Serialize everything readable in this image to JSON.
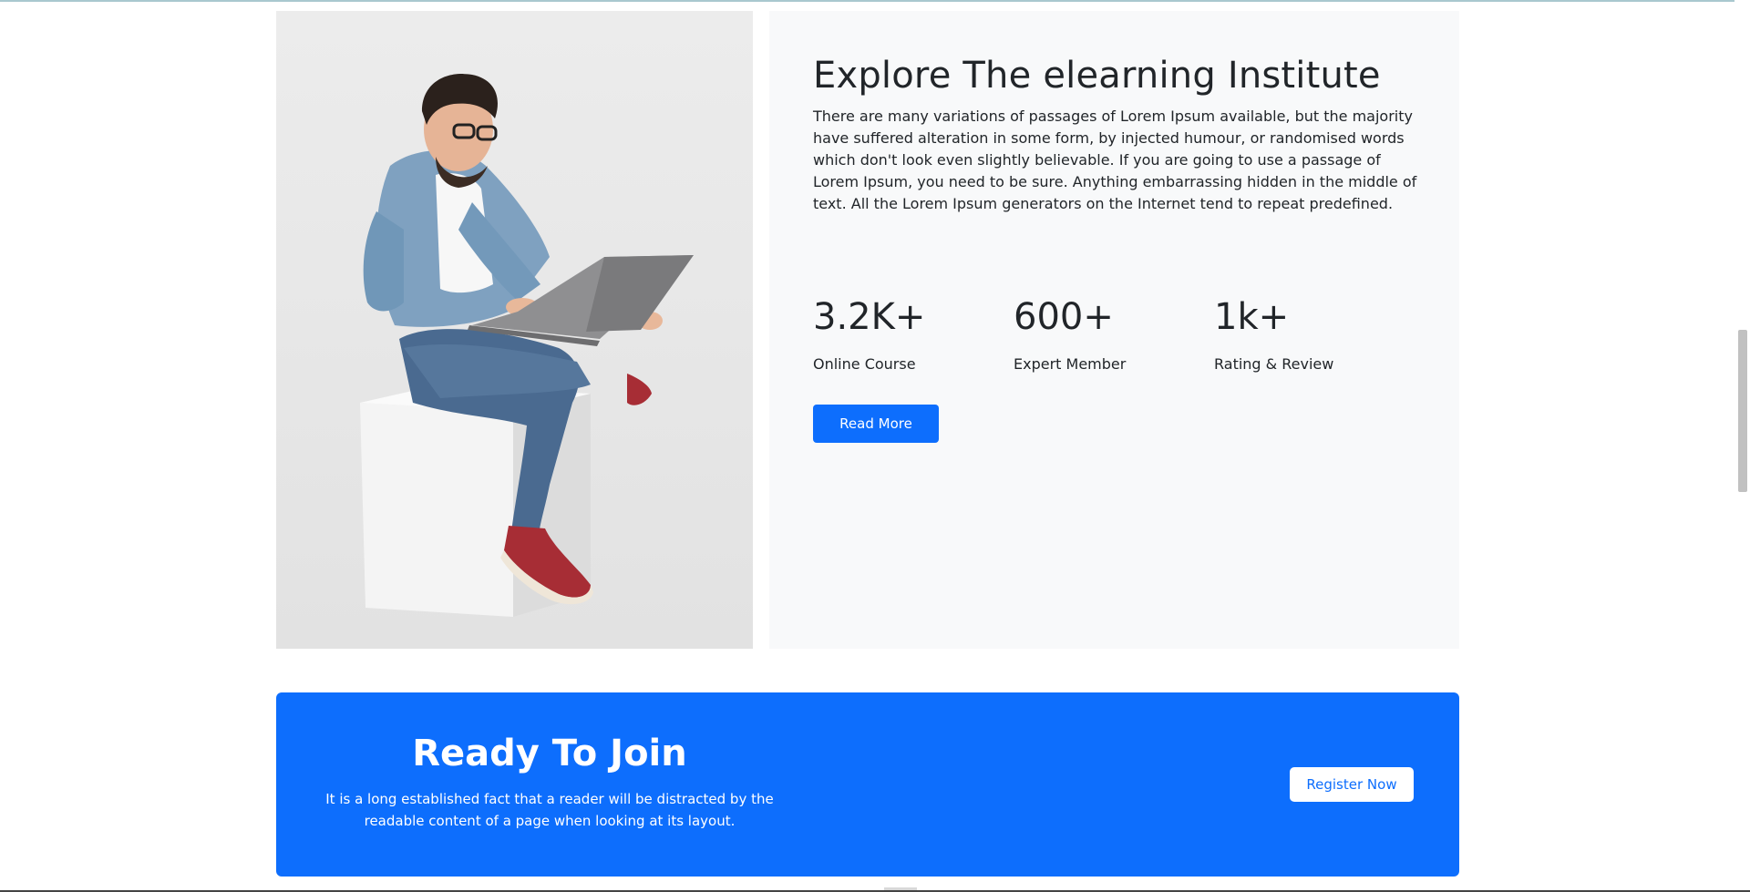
{
  "about": {
    "title": "Explore The elearning Institute",
    "description": "There are many variations of passages of Lorem Ipsum available, but the majority have suffered alteration in some form, by injected humour, or randomised words which don't look even slightly believable. If you are going to use a passage of Lorem Ipsum, you need to be sure. Anything embarrassing hidden in the middle of text. All the Lorem Ipsum generators on the Internet tend to repeat predefined.",
    "stats": [
      {
        "value": "3.2K+",
        "label": "Online Course"
      },
      {
        "value": "600+",
        "label": "Expert Member"
      },
      {
        "value": "1k+",
        "label": "Rating & Review"
      }
    ],
    "read_more_label": "Read More"
  },
  "cta": {
    "title": "Ready To Join",
    "text": "It is a long established fact that a reader will be distracted by the readable content of a page when looking at its layout.",
    "register_label": "Register Now"
  },
  "colors": {
    "primary": "#0d6efd",
    "panel_bg": "#f8f9fa",
    "text": "#212529"
  }
}
